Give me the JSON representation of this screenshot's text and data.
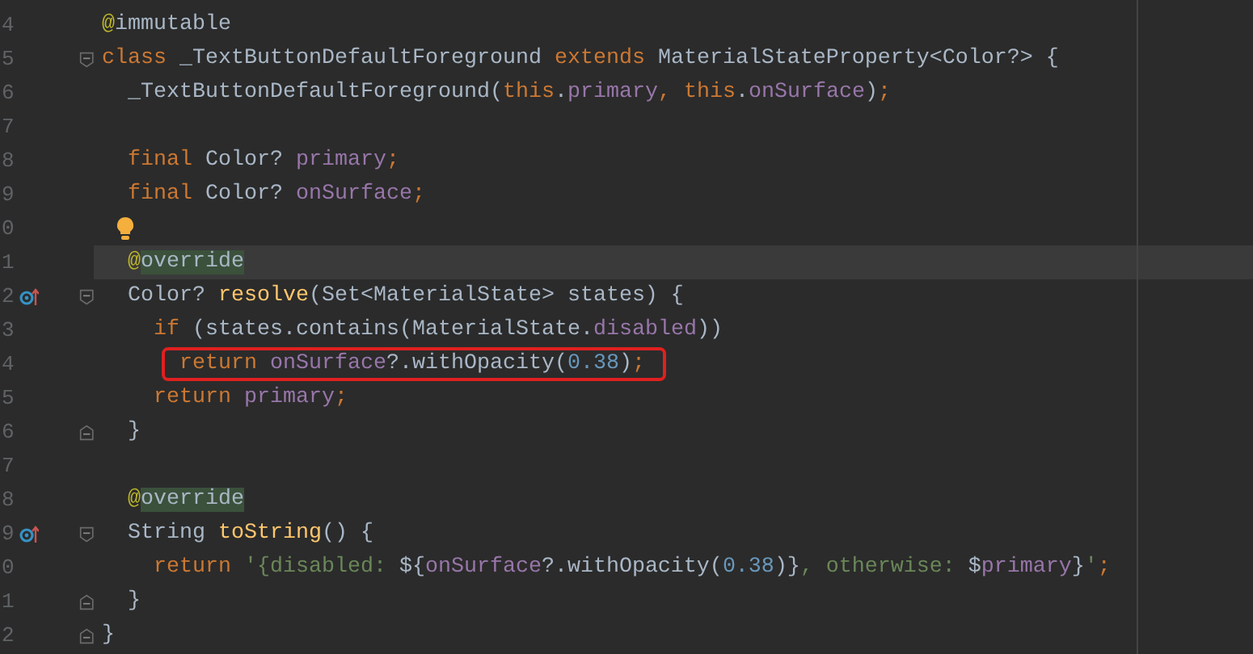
{
  "editor": {
    "lines": [
      {
        "number": "4",
        "tokens": [
          {
            "kind": "annotation",
            "text": "@"
          },
          {
            "kind": "plain",
            "text": "immutable"
          }
        ]
      },
      {
        "number": "5",
        "fold_start": true,
        "tokens": [
          {
            "kind": "keyword",
            "text": "class"
          },
          {
            "kind": "plain",
            "text": " _TextButtonDefaultForeground "
          },
          {
            "kind": "keyword",
            "text": "extends"
          },
          {
            "kind": "plain",
            "text": " MaterialStateProperty<Color?> {"
          }
        ]
      },
      {
        "number": "6",
        "tokens": [
          {
            "kind": "plain",
            "text": "  _TextButtonDefaultForeground("
          },
          {
            "kind": "keyword",
            "text": "this"
          },
          {
            "kind": "plain",
            "text": "."
          },
          {
            "kind": "field",
            "text": "primary"
          },
          {
            "kind": "keyword",
            "text": ", this"
          },
          {
            "kind": "plain",
            "text": "."
          },
          {
            "kind": "field",
            "text": "onSurface"
          },
          {
            "kind": "plain",
            "text": ")"
          },
          {
            "kind": "keyword",
            "text": ";"
          }
        ]
      },
      {
        "number": "7"
      },
      {
        "number": "8",
        "tokens": [
          {
            "kind": "keyword",
            "text": "  final"
          },
          {
            "kind": "plain",
            "text": " Color? "
          },
          {
            "kind": "field",
            "text": "primary"
          },
          {
            "kind": "keyword",
            "text": ";"
          }
        ]
      },
      {
        "number": "9",
        "tokens": [
          {
            "kind": "keyword",
            "text": "  final"
          },
          {
            "kind": "plain",
            "text": " Color? "
          },
          {
            "kind": "field",
            "text": "onSurface"
          },
          {
            "kind": "keyword",
            "text": ";"
          }
        ]
      },
      {
        "number": "0",
        "bulb": true
      },
      {
        "number": "1",
        "current": true,
        "tokens": [
          {
            "kind": "annotation",
            "text": "  @"
          },
          {
            "kind": "plain",
            "text": "override",
            "highlighted": true
          }
        ]
      },
      {
        "number": "2",
        "override_icon": true,
        "fold_start": true,
        "tokens": [
          {
            "kind": "plain",
            "text": "  Color? "
          },
          {
            "kind": "method",
            "text": "resolve"
          },
          {
            "kind": "plain",
            "text": "(Set<MaterialState> states) {"
          }
        ]
      },
      {
        "number": "3",
        "tokens": [
          {
            "kind": "keyword",
            "text": "    if"
          },
          {
            "kind": "plain",
            "text": " (states.contains(MaterialState."
          },
          {
            "kind": "field",
            "text": "disabled"
          },
          {
            "kind": "plain",
            "text": "))"
          }
        ]
      },
      {
        "number": "4",
        "boxed": true,
        "tokens": [
          {
            "kind": "keyword",
            "text": "      return"
          },
          {
            "kind": "field",
            "text": " onSurface"
          },
          {
            "kind": "plain",
            "text": "?.withOpacity("
          },
          {
            "kind": "number",
            "text": "0.38"
          },
          {
            "kind": "plain",
            "text": ")"
          },
          {
            "kind": "keyword",
            "text": ";"
          }
        ]
      },
      {
        "number": "5",
        "tokens": [
          {
            "kind": "keyword",
            "text": "    return"
          },
          {
            "kind": "field",
            "text": " primary"
          },
          {
            "kind": "keyword",
            "text": ";"
          }
        ]
      },
      {
        "number": "6",
        "fold_end": true,
        "tokens": [
          {
            "kind": "plain",
            "text": "  }"
          }
        ]
      },
      {
        "number": "7"
      },
      {
        "number": "8",
        "tokens": [
          {
            "kind": "annotation",
            "text": "  @"
          },
          {
            "kind": "plain",
            "text": "override",
            "highlighted": true
          }
        ]
      },
      {
        "number": "9",
        "override_icon": true,
        "fold_start": true,
        "tokens": [
          {
            "kind": "plain",
            "text": "  String "
          },
          {
            "kind": "method",
            "text": "toString"
          },
          {
            "kind": "plain",
            "text": "() {"
          }
        ]
      },
      {
        "number": "0",
        "tokens": [
          {
            "kind": "keyword",
            "text": "    return"
          },
          {
            "kind": "string",
            "text": " '{disabled: "
          },
          {
            "kind": "plain",
            "text": "${"
          },
          {
            "kind": "field",
            "text": "onSurface"
          },
          {
            "kind": "plain",
            "text": "?.withOpacity("
          },
          {
            "kind": "number",
            "text": "0.38"
          },
          {
            "kind": "plain",
            "text": ")}"
          },
          {
            "kind": "string",
            "text": ", otherwise: "
          },
          {
            "kind": "plain",
            "text": "$"
          },
          {
            "kind": "field",
            "text": "primary"
          },
          {
            "kind": "plain",
            "text": "}"
          },
          {
            "kind": "string",
            "text": "'"
          },
          {
            "kind": "keyword",
            "text": ";"
          }
        ]
      },
      {
        "number": "1",
        "fold_end": true,
        "tokens": [
          {
            "kind": "plain",
            "text": "  }"
          }
        ]
      },
      {
        "number": "2",
        "fold_end": true,
        "tokens": [
          {
            "kind": "plain",
            "text": "}"
          }
        ]
      }
    ]
  }
}
